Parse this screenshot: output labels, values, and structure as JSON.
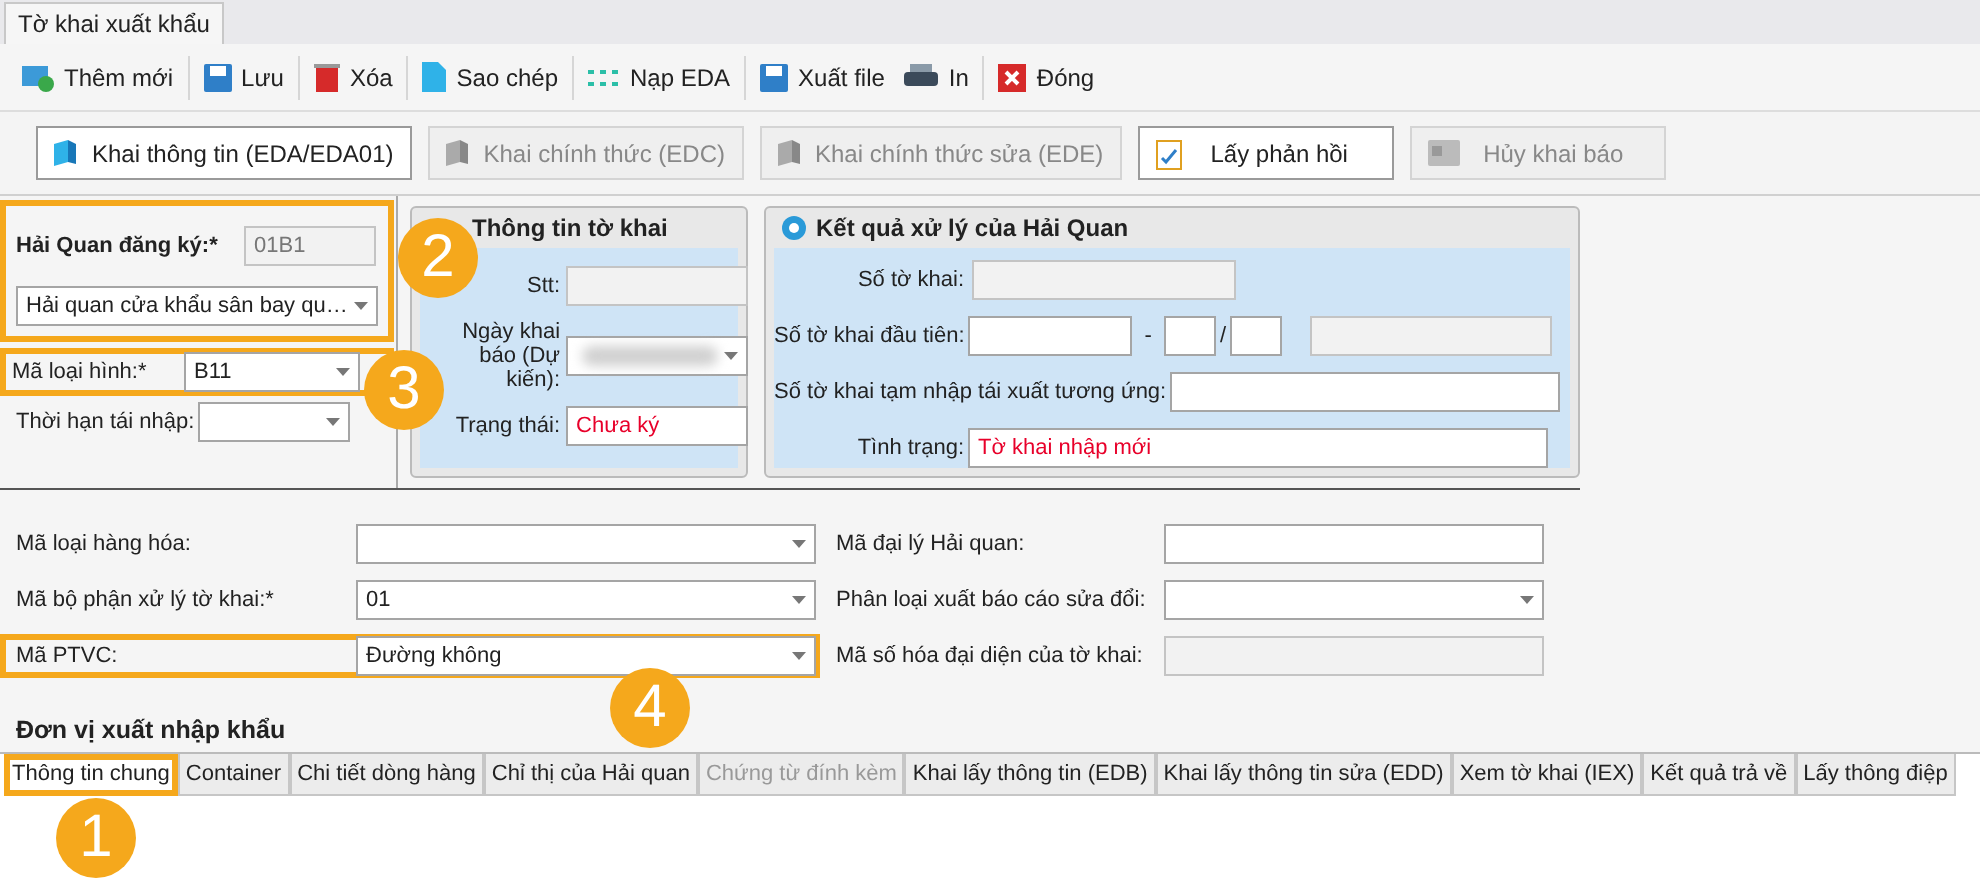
{
  "document_tabs": [
    {
      "label": "Tờ khai xuất khẩu",
      "selected": true
    }
  ],
  "toolbar": [
    {
      "label": "Thêm mới",
      "separator_after": true
    },
    {
      "label": "Lưu",
      "separator_after": true
    },
    {
      "label": "Xóa",
      "separator_after": true
    },
    {
      "label": "Sao chép",
      "separator_after": true
    },
    {
      "label": "Nạp EDA",
      "separator_after": true
    },
    {
      "label": "Xuất file",
      "separator_after": false
    },
    {
      "label": "In",
      "separator_after": true
    },
    {
      "label": "Đóng",
      "separator_after": false
    }
  ],
  "action_buttons": [
    {
      "label": "Khai thông tin (EDA/EDA01)",
      "disabled": false
    },
    {
      "label": "Khai chính thức (EDC)",
      "disabled": true
    },
    {
      "label": "Khai chính thức sửa (EDE)",
      "disabled": true
    },
    {
      "label": "Lấy phản hồi",
      "disabled": false
    },
    {
      "label": "Hủy khai báo",
      "disabled": true
    }
  ],
  "registration": {
    "label": "Hải Quan đăng ký:*",
    "code": "01B1",
    "office": "Hải quan cửa khẩu sân bay qu…",
    "highlighted": true
  },
  "type_field": {
    "label": "Mã loại hình:*",
    "value": "B11",
    "highlighted": true
  },
  "reimport_field": {
    "label": "Thời hạn tái nhập:"
  },
  "declaration_info": {
    "title": "Thông tin tờ khai",
    "fields": [
      {
        "label": "Stt:",
        "kind": "text",
        "readonly": true
      },
      {
        "label": "Ngày khai báo (Dự kiến):",
        "kind": "combo",
        "redacted": true
      },
      {
        "label": "Trạng thái:",
        "kind": "text",
        "value": "Chưa ký",
        "alert": true
      }
    ]
  },
  "customs_result": {
    "title": "Kết quả xử lý của Hải Quan",
    "fields": [
      {
        "label": "Số tờ khai:",
        "kind": "short",
        "readonly": true
      },
      {
        "label": "Số tờ khai đầu tiên:",
        "kind": "split",
        "separators": [
          "-",
          "/"
        ]
      },
      {
        "label": "Số tờ khai tạm nhập tái xuất tương ứng:",
        "kind": "wide"
      },
      {
        "label": "Tình trạng:",
        "kind": "wide",
        "value": "Tờ khai nhập mới",
        "alert": true
      }
    ]
  },
  "general_fields": [
    {
      "label": "Mã loại hàng hóa:",
      "kind": "combo",
      "highlighted": false
    },
    {
      "label": "Mã đại lý Hải quan:",
      "kind": "text",
      "highlighted": false
    },
    {
      "label": "Mã bộ phận xử lý tờ khai:*",
      "kind": "combo",
      "value": "01",
      "highlighted": false
    },
    {
      "label": "Phân loại xuất báo cáo sửa đổi:",
      "kind": "combo",
      "highlighted": false
    },
    {
      "label": "Mã PTVC:",
      "kind": "combo",
      "value": "Đường không",
      "highlighted": true
    },
    {
      "label": "Mã số hóa đại diện của tờ khai:",
      "kind": "text",
      "readonly": true,
      "highlighted": false
    }
  ],
  "section_title": "Đơn vị xuất nhập khẩu",
  "bottom_tabs": [
    {
      "label": "Thông tin chung",
      "selected": true,
      "disabled": false,
      "highlighted": true
    },
    {
      "label": "Container",
      "selected": false,
      "disabled": false,
      "highlighted": false
    },
    {
      "label": "Chi tiết dòng hàng",
      "selected": false,
      "disabled": false,
      "highlighted": false
    },
    {
      "label": "Chỉ thị của Hải quan",
      "selected": false,
      "disabled": false,
      "highlighted": false
    },
    {
      "label": "Chứng từ đính kèm",
      "selected": false,
      "disabled": true,
      "highlighted": false
    },
    {
      "label": "Khai lấy thông tin (EDB)",
      "selected": false,
      "disabled": false,
      "highlighted": false
    },
    {
      "label": "Khai lấy thông tin sửa (EDD)",
      "selected": false,
      "disabled": false,
      "highlighted": false
    },
    {
      "label": "Xem tờ khai (IEX)",
      "selected": false,
      "disabled": false,
      "highlighted": false
    },
    {
      "label": "Kết quả trả về",
      "selected": false,
      "disabled": false,
      "highlighted": false
    },
    {
      "label": "Lấy thông điệp",
      "selected": false,
      "disabled": false,
      "highlighted": false
    }
  ],
  "callouts": [
    {
      "number": "2"
    },
    {
      "number": "3"
    },
    {
      "number": "4"
    },
    {
      "number": "1"
    }
  ]
}
